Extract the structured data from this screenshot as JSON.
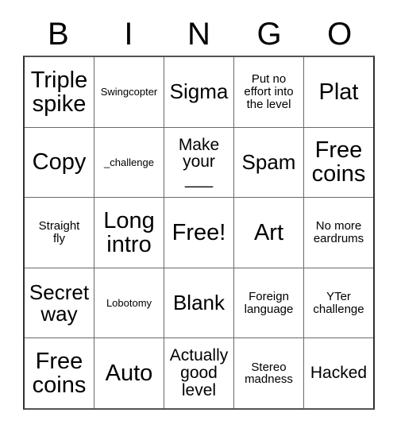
{
  "card": {
    "title_letters": [
      "B",
      "I",
      "N",
      "G",
      "O"
    ],
    "rows": [
      [
        {
          "text": "Triple\nspike",
          "size": "size-xl"
        },
        {
          "text": "Swingcopter",
          "size": "size-xs"
        },
        {
          "text": "Sigma",
          "size": "size-lg"
        },
        {
          "text": "Put no\neffort into\nthe level",
          "size": "size-sm"
        },
        {
          "text": "Plat",
          "size": "size-xl"
        }
      ],
      [
        {
          "text": "Copy",
          "size": "size-xl"
        },
        {
          "text": "_challenge",
          "size": "size-xs"
        },
        {
          "text": "Make\nyour\n___",
          "size": "size-md"
        },
        {
          "text": "Spam",
          "size": "size-lg"
        },
        {
          "text": "Free\ncoins",
          "size": "size-xl"
        }
      ],
      [
        {
          "text": "Straight\nfly",
          "size": "size-sm"
        },
        {
          "text": "Long\nintro",
          "size": "size-xl"
        },
        {
          "text": "Free!",
          "size": "size-xl"
        },
        {
          "text": "Art",
          "size": "size-xl"
        },
        {
          "text": "No more\neardrums",
          "size": "size-sm"
        }
      ],
      [
        {
          "text": "Secret\nway",
          "size": "size-lg"
        },
        {
          "text": "Lobotomy",
          "size": "size-xs"
        },
        {
          "text": "Blank",
          "size": "size-lg"
        },
        {
          "text": "Foreign\nlanguage",
          "size": "size-sm"
        },
        {
          "text": "YTer\nchallenge",
          "size": "size-sm"
        }
      ],
      [
        {
          "text": "Free\ncoins",
          "size": "size-xl"
        },
        {
          "text": "Auto",
          "size": "size-xl"
        },
        {
          "text": "Actually\ngood\nlevel",
          "size": "size-md"
        },
        {
          "text": "Stereo\nmadness",
          "size": "size-sm"
        },
        {
          "text": "Hacked",
          "size": "size-md"
        }
      ]
    ]
  }
}
